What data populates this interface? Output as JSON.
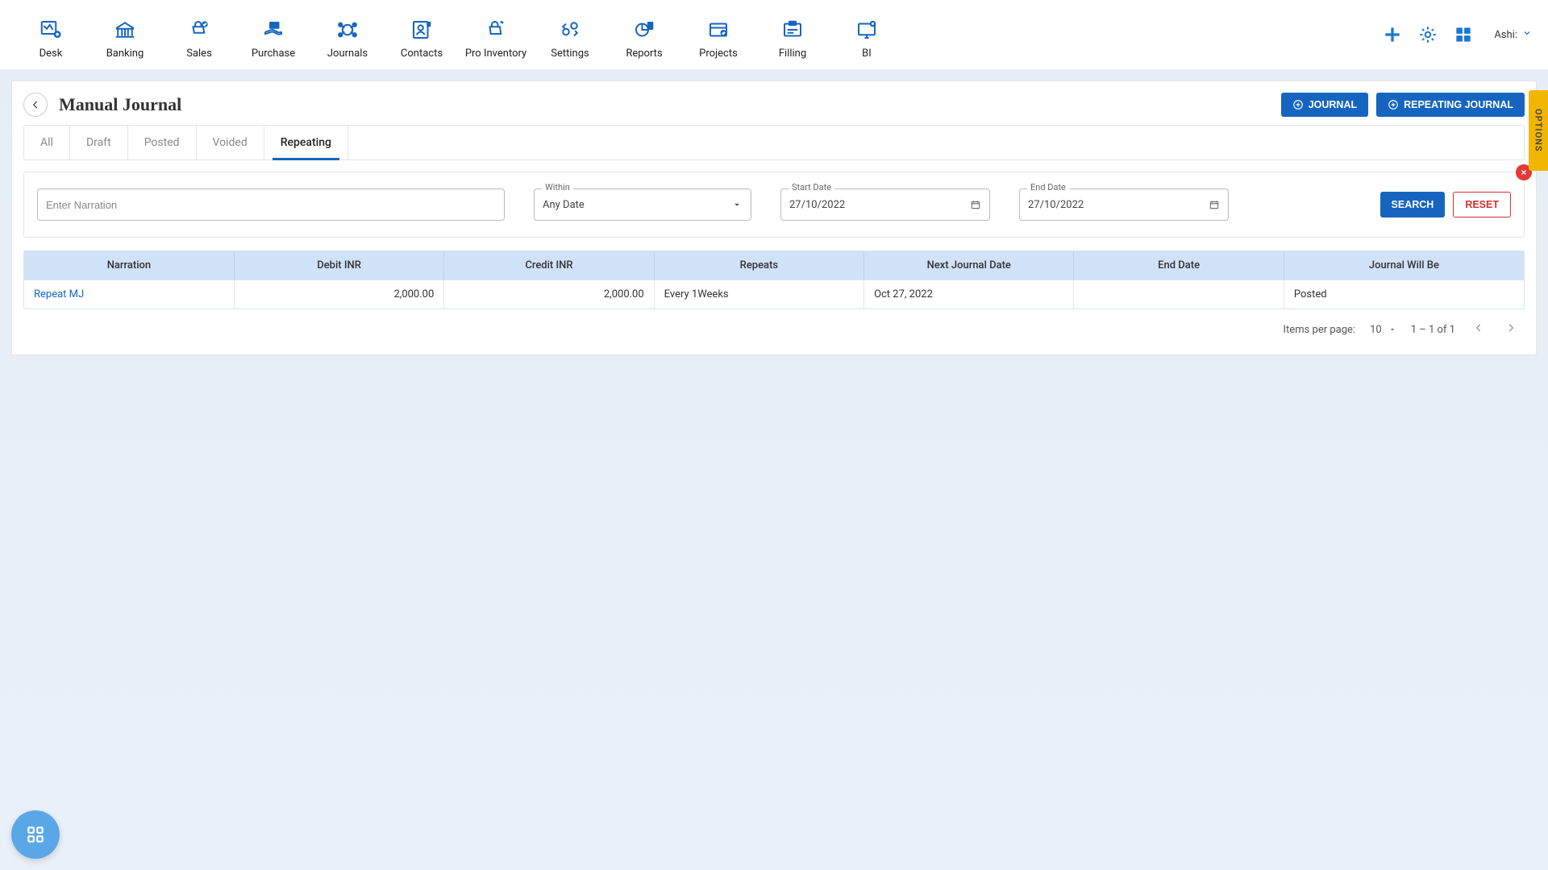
{
  "nav": {
    "items": [
      {
        "label": "Desk"
      },
      {
        "label": "Banking"
      },
      {
        "label": "Sales"
      },
      {
        "label": "Purchase"
      },
      {
        "label": "Journals"
      },
      {
        "label": "Contacts"
      },
      {
        "label": "Pro Inventory"
      },
      {
        "label": "Settings"
      },
      {
        "label": "Reports"
      },
      {
        "label": "Projects"
      },
      {
        "label": "Filling"
      },
      {
        "label": "BI"
      }
    ],
    "user": "Ashi:"
  },
  "page": {
    "title": "Manual Journal",
    "journal_btn": "JOURNAL",
    "repeating_btn": "REPEATING JOURNAL"
  },
  "tabs": {
    "items": [
      "All",
      "Draft",
      "Posted",
      "Voided",
      "Repeating"
    ],
    "active_index": 4
  },
  "filter": {
    "narration_placeholder": "Enter Narration",
    "within_label": "Within",
    "within_value": "Any Date",
    "start_label": "Start Date",
    "start_value": "27/10/2022",
    "end_label": "End Date",
    "end_value": "27/10/2022",
    "search_btn": "SEARCH",
    "reset_btn": "RESET"
  },
  "table": {
    "headers": [
      "Narration",
      "Debit INR",
      "Credit INR",
      "Repeats",
      "Next Journal Date",
      "End Date",
      "Journal Will Be"
    ],
    "rows": [
      {
        "narration": "Repeat MJ",
        "debit": "2,000.00",
        "credit": "2,000.00",
        "repeats": "Every 1Weeks",
        "next": "Oct 27, 2022",
        "end": "",
        "status": "Posted"
      }
    ]
  },
  "pager": {
    "ipp_label": "Items per page:",
    "ipp_value": "10",
    "range": "1 – 1 of 1"
  },
  "options_tab": "OPTIONS"
}
